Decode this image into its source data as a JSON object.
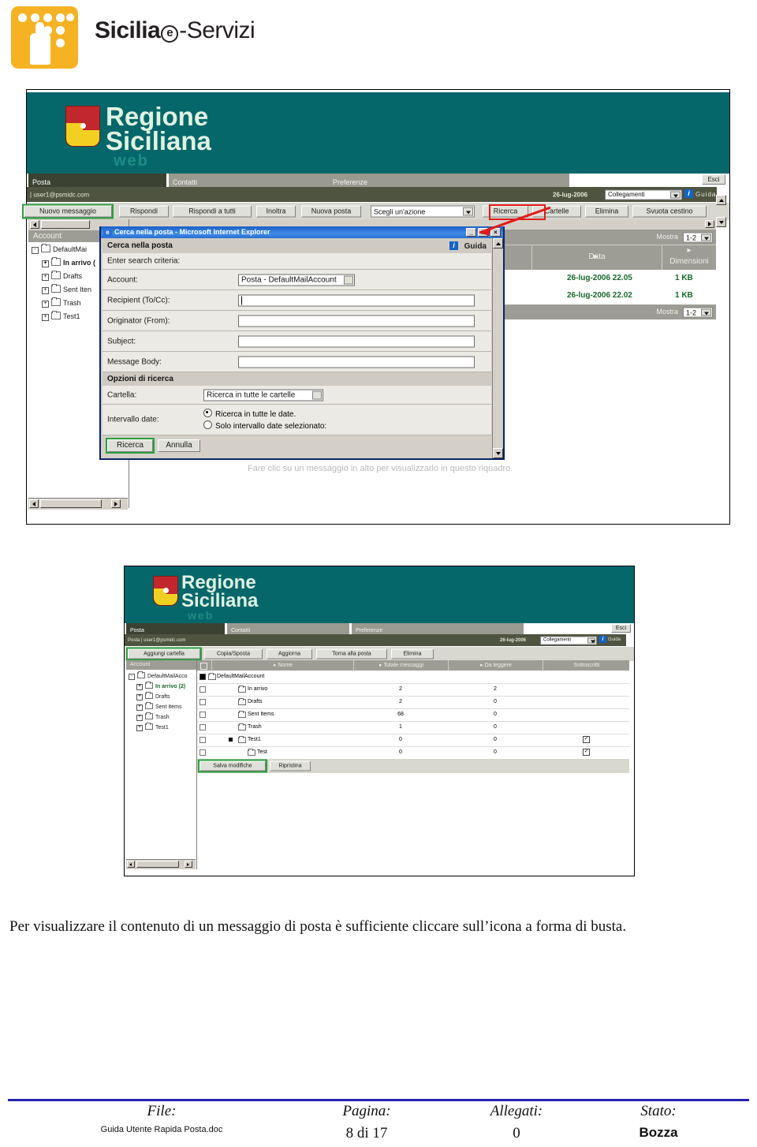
{
  "brand": {
    "name_bold": "Sicilia",
    "name_rest": "-Servizi",
    "e_letter": "e",
    "logo_name": "sicilia-e-servizi-logo"
  },
  "screenshot1": {
    "banner": {
      "line1": "Regione",
      "line2": "Siciliana",
      "line3": "web",
      "crest_name": "trinacria-crest"
    },
    "tabs": [
      {
        "label": "Posta",
        "active": true
      },
      {
        "label": "Contatti",
        "active": false
      },
      {
        "label": "Preferenze",
        "active": false
      }
    ],
    "logout_label": "Esci",
    "account_bar": {
      "prefix": "|",
      "account": "user1@psmidc.com",
      "date": "26-lug-2006",
      "links_select": "Collegamenti",
      "help_icon": "i",
      "help_label": "Guida"
    },
    "toolbar": {
      "buttons": [
        "Nuovo messaggio",
        "Rispondi",
        "Rispondi a tutti",
        "Inoltra",
        "Nuova posta"
      ],
      "action_select": "Scegli un'azione",
      "right_buttons": [
        "Ricerca",
        "Cartelle",
        "Elimina",
        "Svuota cestino"
      ]
    },
    "tree": {
      "header": "Account",
      "root": "DefaultMai",
      "items": [
        "In arrivo (",
        "Drafts",
        "Sent Iten",
        "Trash",
        "Test1"
      ]
    },
    "list": {
      "mostra_label": "Mostra",
      "mostra_value": "1-2",
      "columns": [
        "Data",
        "Dimensioni"
      ],
      "rows": [
        {
          "date": "26-lug-2006 22.05",
          "size": "1 KB"
        },
        {
          "date": "26-lug-2006 22.02",
          "size": "1 KB"
        }
      ],
      "footer_mostra_label": "Mostra",
      "footer_mostra_value": "1-2"
    },
    "preview_hint": "Fare clic su un messaggio in alto per visualizzarlo in questo riquadro."
  },
  "dialog": {
    "window_title": "Cerca nella posta - Microsoft Internet Explorer",
    "minimize": "_",
    "maximize": "□",
    "close": "×",
    "heading": "Cerca nella posta",
    "help_icon": "i",
    "help_label": "Guida",
    "subheading": "Enter search criteria:",
    "fields": [
      {
        "label": "Account:",
        "type": "select",
        "value": "Posta - DefaultMailAccount"
      },
      {
        "label": "Recipient (To/Cc):",
        "type": "text",
        "value": ""
      },
      {
        "label": "Originator (From):",
        "type": "text",
        "value": ""
      },
      {
        "label": "Subject:",
        "type": "text",
        "value": ""
      },
      {
        "label": "Message Body:",
        "type": "text",
        "value": ""
      }
    ],
    "options_heading": "Opzioni di ricerca",
    "folder_label": "Cartella:",
    "folder_value": "Ricerca in tutte le cartelle",
    "daterange_label": "Intervallo date:",
    "radio_all": "Ricerca in tutte le date.",
    "radio_only": "Solo intervallo date selezionato:",
    "submit_label": "Ricerca",
    "cancel_label": "Annulla"
  },
  "screenshot2": {
    "banner": {
      "line1": "Regione",
      "line2": "Siciliana",
      "line3": "web"
    },
    "tabs": [
      {
        "label": "Posta",
        "active": true
      },
      {
        "label": "Contatti",
        "active": false
      },
      {
        "label": "Preferenze",
        "active": false
      }
    ],
    "logout_label": "Esci",
    "account_bar": {
      "prefix": "Posta   |",
      "account": "user1@psmidc.com",
      "date": "26-lug-2006",
      "links_select": "Collegamenti",
      "help_icon": "i",
      "help_label": "Guida"
    },
    "toolbar": {
      "buttons": [
        "Aggiungi cartella",
        "Copia/Sposta",
        "Aggiorna",
        "Torna alla posta",
        "Elimina"
      ]
    },
    "tree": {
      "header": "Account",
      "root": "DefaultMailAcco",
      "items": [
        "In arrivo (2)",
        "Drafts",
        "Sent Items",
        "Trash",
        "Test1"
      ]
    },
    "table": {
      "columns": [
        "",
        "Nome",
        "Totale messaggi",
        "Da leggere",
        "Sottoscritti"
      ],
      "rows": [
        {
          "name": "DefaultMailAccount",
          "total": "",
          "unread": "",
          "subscribed": "",
          "indent": 0,
          "root": true
        },
        {
          "name": "In arrivo",
          "total": "2",
          "unread": "2",
          "subscribed": "",
          "indent": 1
        },
        {
          "name": "Drafts",
          "total": "2",
          "unread": "0",
          "subscribed": "",
          "indent": 1
        },
        {
          "name": "Sent Items",
          "total": "68",
          "unread": "0",
          "subscribed": "",
          "indent": 1
        },
        {
          "name": "Trash",
          "total": "1",
          "unread": "0",
          "subscribed": "",
          "indent": 1
        },
        {
          "name": "Test1",
          "total": "0",
          "unread": "0",
          "subscribed": "checked",
          "indent": 1
        },
        {
          "name": "Test",
          "total": "0",
          "unread": "0",
          "subscribed": "checked",
          "indent": 2
        }
      ],
      "save_label": "Salva modifiche",
      "reset_label": "Ripristina"
    }
  },
  "body_paragraph": "Per visualizzare il contenuto di un messaggio di posta è sufficiente cliccare sull’icona a forma di busta.",
  "footer": {
    "columns": [
      {
        "head": "File:",
        "value": "Guida Utente Rapida Posta.doc"
      },
      {
        "head": "Pagina:",
        "value": "8 di 17"
      },
      {
        "head": "Allegati:",
        "value": "0"
      },
      {
        "head": "Stato:",
        "value": "Bozza"
      }
    ]
  },
  "colors": {
    "brand_yellow": "#F5B324",
    "teal": "#06676A",
    "olive": "#4E5440",
    "green_highlight": "#2C9E3F",
    "red_annotation": "#E01B1B",
    "footer_rule": "#2222B0"
  }
}
